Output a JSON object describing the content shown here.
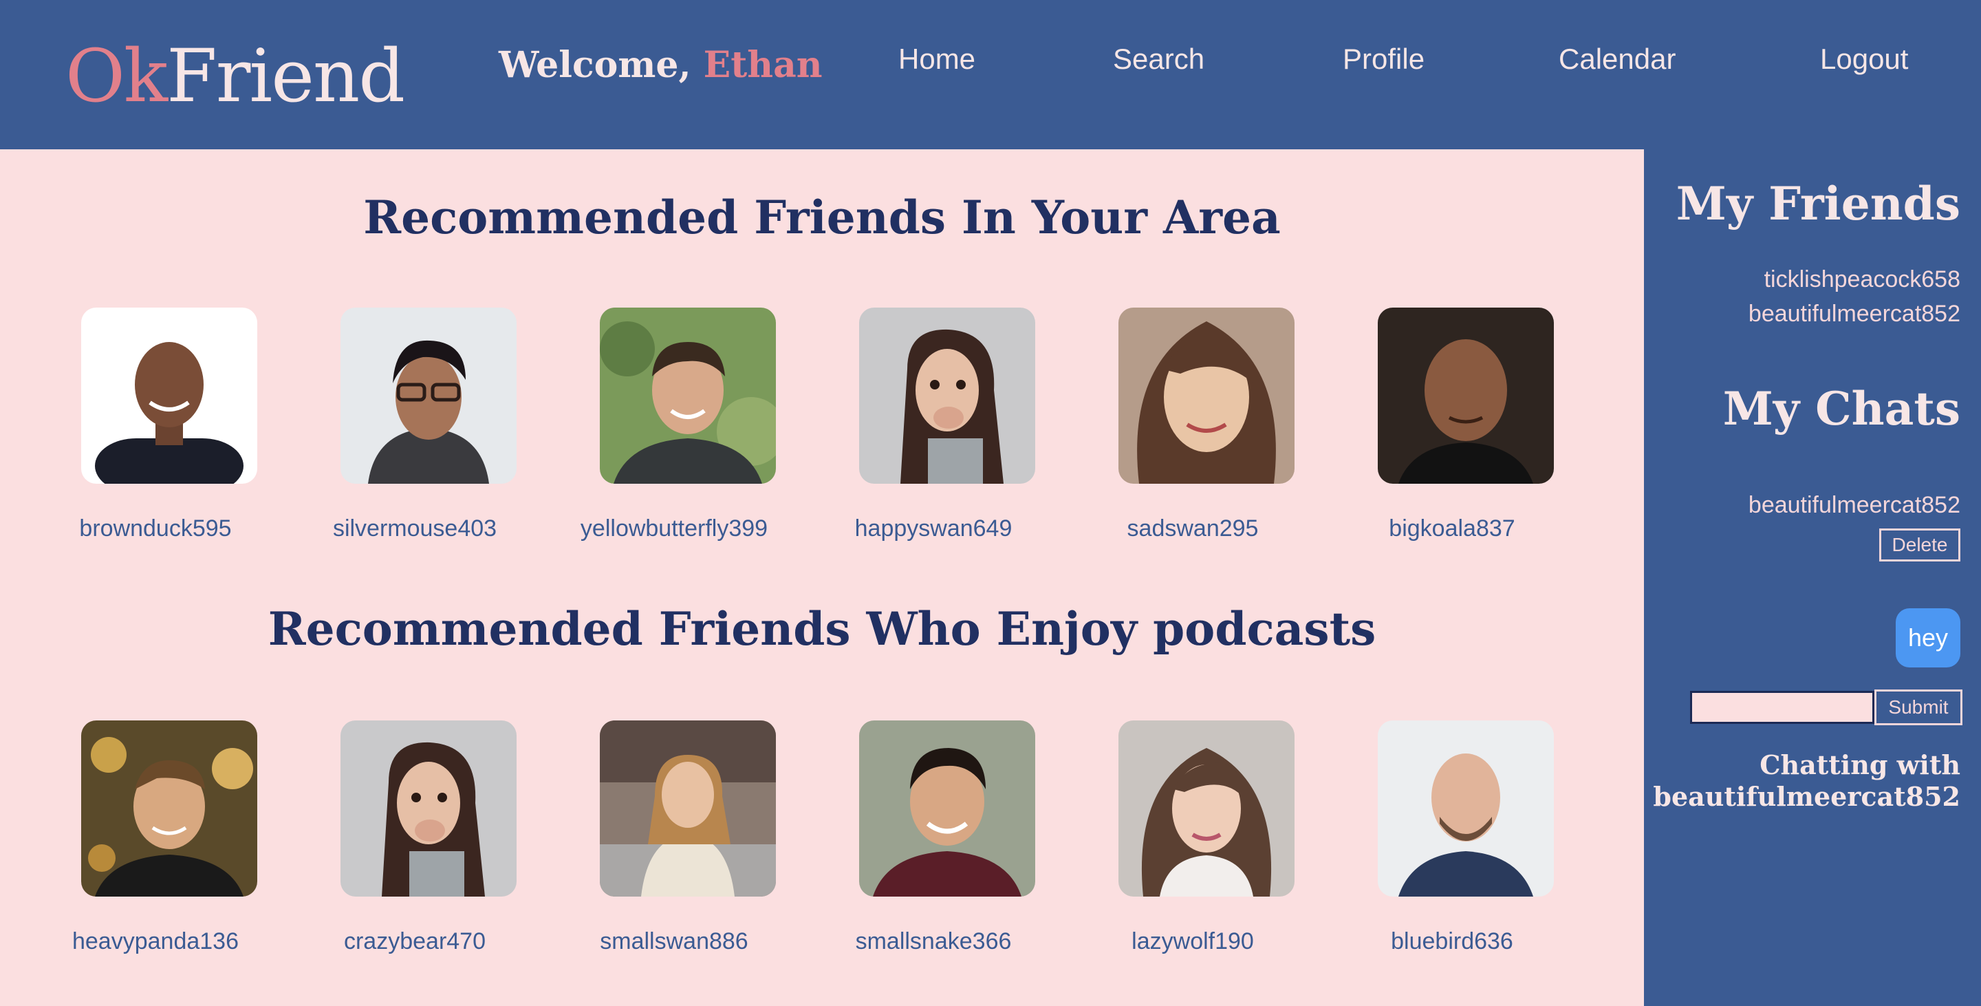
{
  "header": {
    "logo_ok": "Ok",
    "logo_friend": "Friend",
    "welcome_prefix": "Welcome, ",
    "welcome_user": "Ethan",
    "nav": {
      "home": "Home",
      "search": "Search",
      "profile": "Profile",
      "calendar": "Calendar",
      "logout": "Logout"
    }
  },
  "main": {
    "area_title": "Recommended Friends In Your Area",
    "podcast_title": "Recommended Friends Who Enjoy podcasts",
    "area_friends": [
      {
        "username": "brownduck595"
      },
      {
        "username": "silvermouse403"
      },
      {
        "username": "yellowbutterfly399"
      },
      {
        "username": "happyswan649"
      },
      {
        "username": "sadswan295"
      },
      {
        "username": "bigkoala837"
      }
    ],
    "podcast_friends": [
      {
        "username": "heavypanda136"
      },
      {
        "username": "crazybear470"
      },
      {
        "username": "smallswan886"
      },
      {
        "username": "smallsnake366"
      },
      {
        "username": "lazywolf190"
      },
      {
        "username": "bluebird636"
      }
    ]
  },
  "sidebar": {
    "friends_title": "My Friends",
    "friends": [
      "ticklishpeacock658",
      "beautifulmeercat852"
    ],
    "chats_title": "My Chats",
    "chats": [
      {
        "name": "beautifulmeercat852",
        "delete_label": "Delete"
      }
    ],
    "message": "hey",
    "input_value": "",
    "submit_label": "Submit",
    "chatting_prefix": "Chatting with",
    "chatting_user": "beautifulmeercat852"
  },
  "colors": {
    "header_bg": "#3b5b93",
    "main_bg": "#fbdfe0",
    "accent_pink": "#e2808b",
    "title_navy": "#213062",
    "bubble_blue": "#4c97f2"
  }
}
